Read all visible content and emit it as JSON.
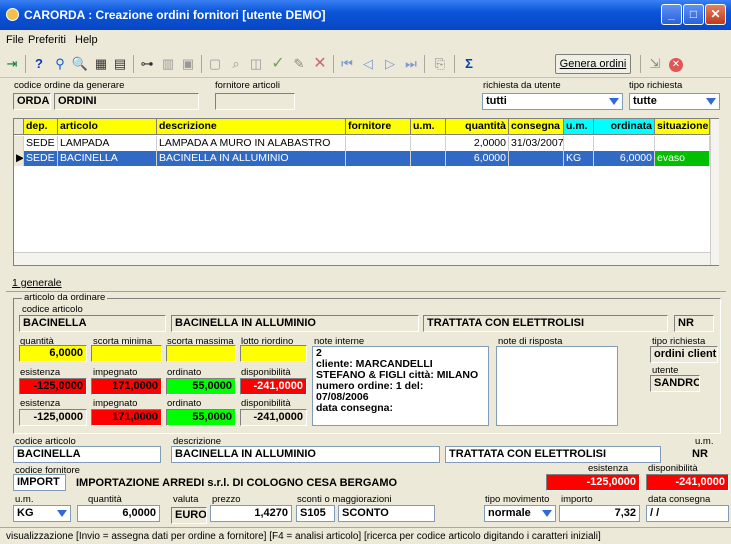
{
  "window": {
    "title": "CARORDA : Creazione ordini fornitori [utente DEMO]"
  },
  "menu": [
    "File",
    "Preferiti",
    "Help"
  ],
  "toolbar": {
    "genera_label": "Genera ordini"
  },
  "header": {
    "codice_label": "codice ordine da generare",
    "codice": "ORDA",
    "codice_desc": "ORDINI",
    "fornitore_label": "fornitore articoli",
    "fornitore": "",
    "richiesta_label": "richiesta da utente",
    "richiesta": "tutti",
    "tipo_label": "tipo richiesta",
    "tipo": "tutte"
  },
  "grid": {
    "columns": [
      "dep.",
      "articolo",
      "descrizione",
      "fornitore",
      "u.m.",
      "quantità",
      "consegna",
      "u.m.",
      "ordinata",
      "situazione"
    ],
    "rows": [
      {
        "dep": "SEDE",
        "articolo": "LAMPADA",
        "descrizione": "LAMPADA A MURO IN ALABASTRO",
        "fornitore": "",
        "um": "",
        "quantita": "2,0000",
        "consegna": "31/03/2007",
        "um2": "",
        "ordinata": "",
        "situazione": ""
      },
      {
        "dep": "SEDE",
        "articolo": "BACINELLA",
        "descrizione": "BACINELLA IN ALLUMINIO",
        "fornitore": "",
        "um": "",
        "quantita": "6,0000",
        "consegna": "",
        "um2": "KG",
        "ordinata": "6,0000",
        "situazione": "evaso"
      }
    ]
  },
  "tab": {
    "label": "1 generale"
  },
  "articolo": {
    "group_label": "articolo da ordinare",
    "codice_label": "codice articolo",
    "codice": "BACINELLA",
    "descrizione": "BACINELLA IN ALLUMINIO",
    "descr2": "TRATTATA CON ELETTROLISI",
    "um": "NR",
    "quantita_label": "quantità",
    "quantita": "6,0000",
    "scorta_min_label": "scorta minima",
    "scorta_max_label": "scorta massima",
    "lotto_label": "lotto riordino",
    "note_interne_label": "note interne",
    "note_interne": [
      "2",
      "cliente: MARCANDELLI",
      "STEFANO & FIGLI città: MILANO",
      "numero ordine: 1 del:",
      "07/08/2006",
      "data consegna:"
    ],
    "note_risposta_label": "note di risposta",
    "tipo_richiesta_label": "tipo richiesta",
    "tipo_richiesta": "ordini clienti",
    "utente_label": "utente",
    "utente": "SANDRO",
    "row1": {
      "esistenza_label": "esistenza",
      "impegnato_label": "impegnato",
      "ordinato_label": "ordinato",
      "disponibilita_label": "disponibilità",
      "esistenza": "-125,0000",
      "impegnato": "171,0000",
      "ordinato": "55,0000",
      "disponibilita": "-241,0000"
    },
    "row2": {
      "esistenza_label": "esistenza",
      "impegnato_label": "impegnato",
      "ordinato_label": "ordinato",
      "disponibilita_label": "disponibilità",
      "esistenza": "-125,0000",
      "impegnato": "171,0000",
      "ordinato": "55,0000",
      "disponibilita": "-241,0000"
    }
  },
  "ordine": {
    "codice_label": "codice articolo",
    "codice": "BACINELLA",
    "descrizione_label": "descrizione",
    "descrizione": "BACINELLA IN ALLUMINIO",
    "descr2": "TRATTATA CON ELETTROLISI",
    "um_label": "u.m.",
    "um": "NR",
    "fornitore_label": "codice fornitore",
    "fornitore": "IMPORT",
    "fornitore_desc": "IMPORTAZIONE ARREDI s.r.l. DI COLOGNO CESA BERGAMO",
    "esistenza_label": "esistenza",
    "esistenza": "-125,0000",
    "disponibilita_label": "disponibilità",
    "disponibilita": "-241,0000",
    "um2_label": "u.m.",
    "um2": "KG",
    "quantita_label": "quantità",
    "quantita": "6,0000",
    "valuta_label": "valuta",
    "valuta": "EURO",
    "prezzo_label": "prezzo",
    "prezzo": "1,4270",
    "sconti_label": "sconti o maggiorazioni",
    "sconto_cod": "S105",
    "sconto_desc": "SCONTO",
    "tipo_mov_label": "tipo movimento",
    "tipo_mov": "normale",
    "importo_label": "importo",
    "importo": "7,32",
    "data_label": "data consegna",
    "data": "/ /"
  },
  "status": "visualizzazione   [Invio = assegna dati per ordine a fornitore] [F4 = analisi articolo] [ricerca per codice articolo digitando i caratteri iniziali]",
  "colors": {
    "title": "#0a55d9",
    "highlight_yellow": "#ffff00",
    "alert_red": "#ff0000",
    "ok_green": "#00ff00",
    "selection": "#316ac5"
  }
}
